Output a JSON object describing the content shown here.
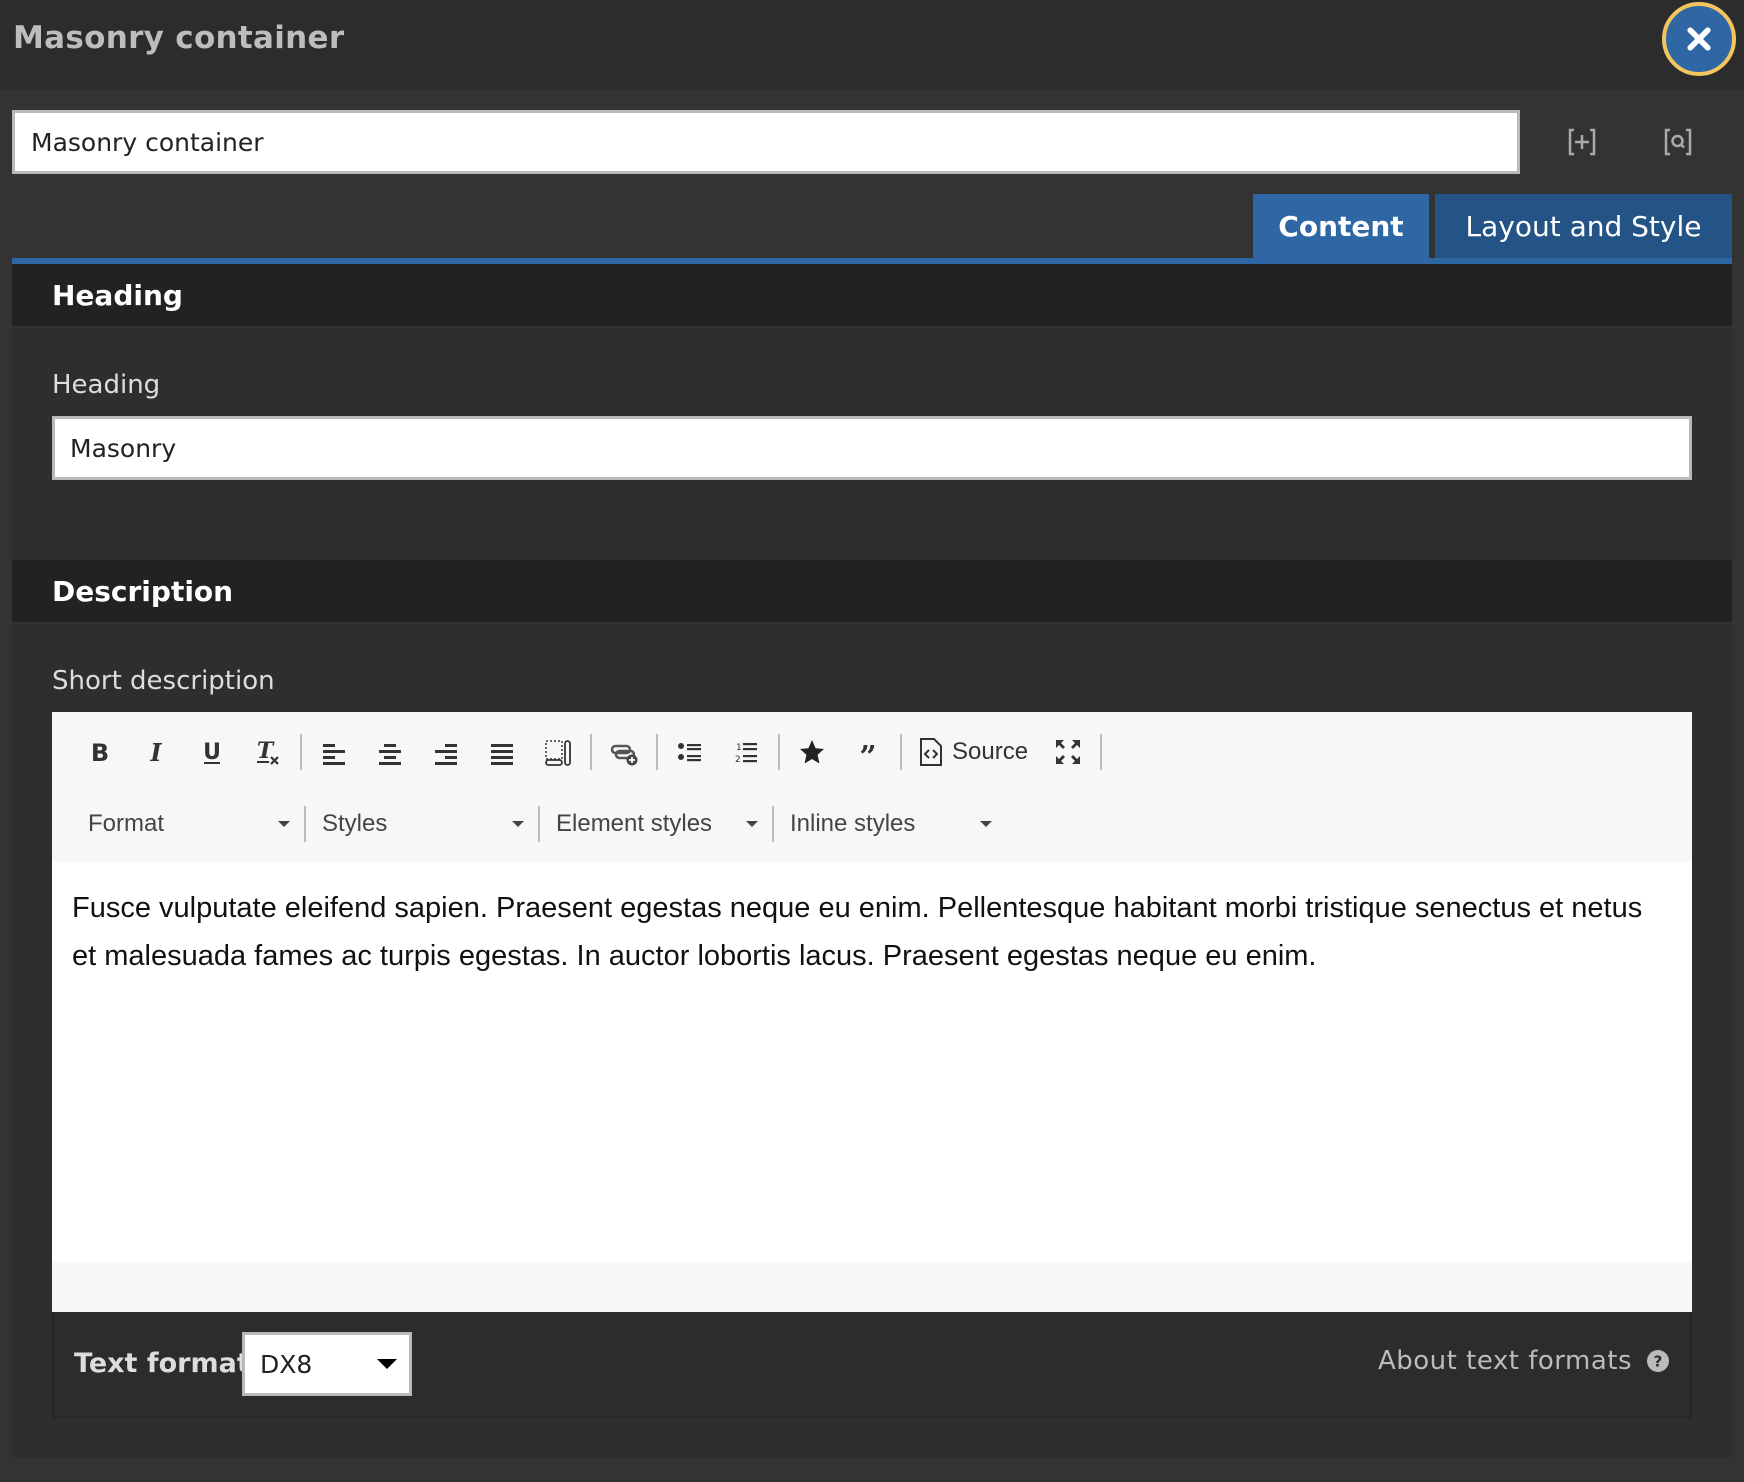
{
  "header": {
    "title": "Masonry container",
    "close_icon": "close-icon"
  },
  "name_field": {
    "value": "Masonry container",
    "icons": [
      "expand-bracket-plus-icon",
      "search-bracket-icon"
    ]
  },
  "tabs": [
    {
      "label": "Content",
      "active": true
    },
    {
      "label": "Layout and Style",
      "active": false
    }
  ],
  "sections": {
    "heading": {
      "title": "Heading",
      "field_label": "Heading",
      "field_value": "Masonry"
    },
    "description": {
      "title": "Description",
      "field_label": "Short description"
    }
  },
  "editor": {
    "toolbar_buttons": [
      "bold",
      "italic",
      "underline",
      "remove-format",
      "align-left",
      "align-center",
      "align-right",
      "justify",
      "show-blocks",
      "link",
      "bulleted-list",
      "numbered-list",
      "star",
      "blockquote",
      "source",
      "maximize"
    ],
    "source_label": "Source",
    "dropdowns": [
      {
        "label": "Format"
      },
      {
        "label": "Styles"
      },
      {
        "label": "Element styles"
      },
      {
        "label": "Inline styles"
      }
    ],
    "content": "Fusce vulputate eleifend sapien. Praesent egestas neque eu enim. Pellentesque habitant morbi tristique senectus et netus et malesuada fames ac turpis egestas. In auctor lobortis lacus. Praesent egestas neque eu enim."
  },
  "text_format": {
    "label": "Text format",
    "selected": "DX8",
    "about_link": "About text formats"
  },
  "colors": {
    "accent_blue": "#2e67a3",
    "tab_inactive": "#235485",
    "close_ring": "#f4c55e"
  }
}
